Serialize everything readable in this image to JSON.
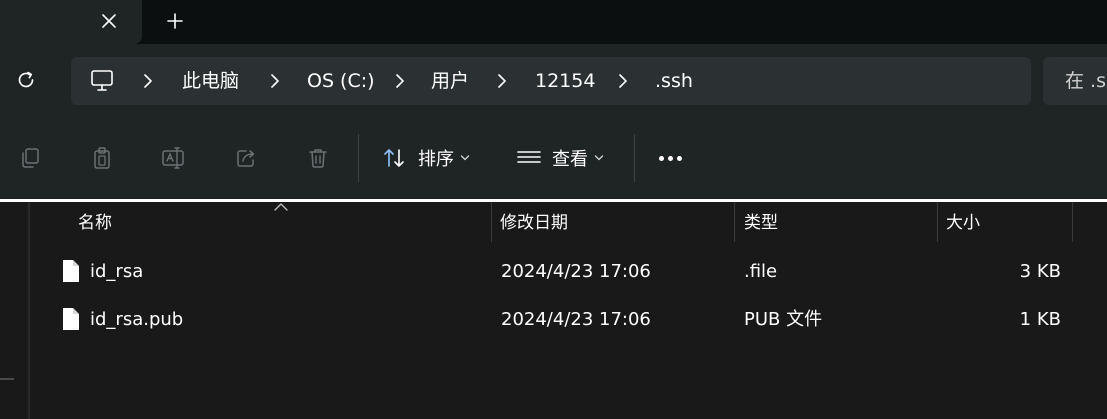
{
  "tabbar": {
    "close_icon": "close-icon",
    "add_icon": "plus-icon"
  },
  "address": {
    "refresh_icon": "refresh-icon",
    "root_icon": "this-pc-icon",
    "breadcrumbs": [
      "此电脑",
      "OS (C:)",
      "用户",
      "12154",
      ".ssh"
    ],
    "search_placeholder": "在 .s"
  },
  "commandbar": {
    "icons": [
      "copy-icon",
      "paste-icon",
      "rename-icon",
      "share-icon",
      "delete-icon"
    ],
    "sort_label": "排序",
    "view_label": "查看",
    "more_icon": "more-icon"
  },
  "columns": {
    "name": "名称",
    "modified": "修改日期",
    "type": "类型",
    "size": "大小"
  },
  "files": [
    {
      "name": "id_rsa",
      "modified": "2024/4/23 17:06",
      "type": ".file",
      "size": "3 KB"
    },
    {
      "name": "id_rsa.pub",
      "modified": "2024/4/23 17:06",
      "type": "PUB 文件",
      "size": "1 KB"
    }
  ],
  "colors": {
    "background": "#191919",
    "toolbar": "#1f2425",
    "addressbar": "#2b3133",
    "text": "#ffffff"
  }
}
